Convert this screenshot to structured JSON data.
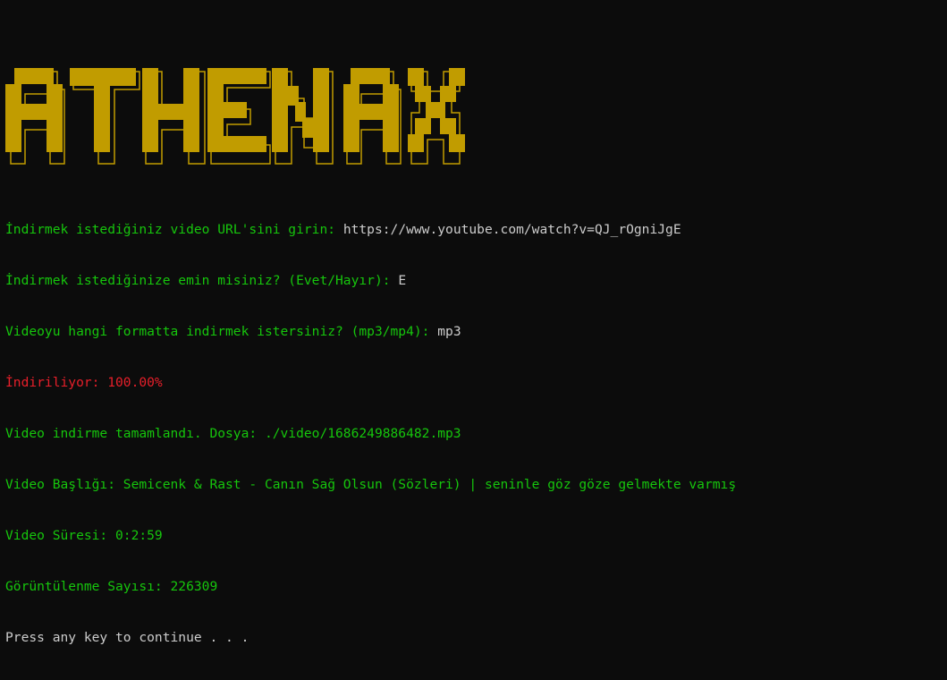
{
  "colors": {
    "background": "#0c0c0c",
    "banner": "#c19c00",
    "prompt": "#16c60c",
    "input": "#cccccc",
    "progress": "#e81f2a"
  },
  "banner": {
    "text": "ATHENAX"
  },
  "lines": [
    {
      "prompt": "İndirmek istediğiniz video URL'sini girin: ",
      "input": "https://www.youtube.com/watch?v=QJ_rOgniJgE"
    },
    {
      "prompt": "İndirmek istediğinize emin misiniz? (Evet/Hayır): ",
      "input": "E"
    },
    {
      "prompt": "Videoyu hangi formatta indirmek istersiniz? (mp3/mp4): ",
      "input": "mp3"
    },
    {
      "progress": "İndiriliyor: 100.00%"
    },
    {
      "text": "Video indirme tamamlandı. Dosya: ./video/1686249886482.mp3"
    },
    {
      "text": "Video Başlığı: Semicenk & Rast - Canın Sağ Olsun (Sözleri) | seninle göz göze gelmekte varmış"
    },
    {
      "text": "Video Süresi: 0:2:59"
    },
    {
      "text": "Görüntülenme Sayısı: 226309"
    },
    {
      "plain": "Press any key to continue . . ."
    }
  ]
}
